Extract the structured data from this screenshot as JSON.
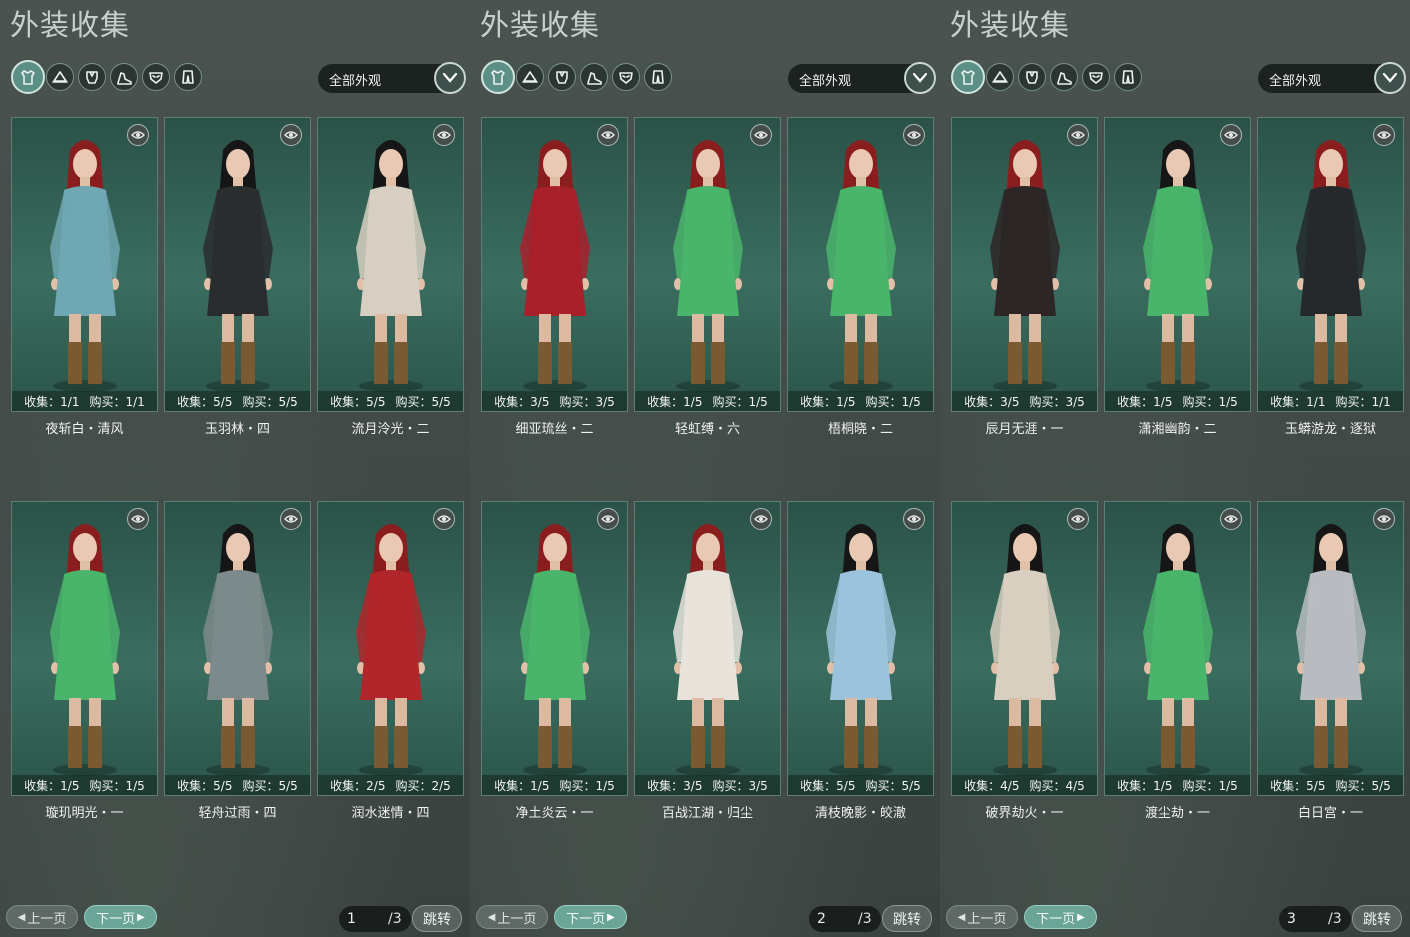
{
  "panels": [
    {
      "title": "外装收集",
      "filter": "全部外观",
      "current_page": "1",
      "total_pages": "/3",
      "buttons": {
        "prev": "上一页",
        "next": "下一页",
        "jump": "跳转"
      },
      "items": [
        {
          "collect": "收集：1/1",
          "buy": "购买：1/1",
          "name": "夜斩白・清风",
          "outfit": "#6fa7b3",
          "hair": "#8a1d1d"
        },
        {
          "collect": "收集：5/5",
          "buy": "购买：5/5",
          "name": "玉羽林・四",
          "outfit": "#2a2d2e",
          "hair": "#161616"
        },
        {
          "collect": "收集：5/5",
          "buy": "购买：5/5",
          "name": "流月泠光・二",
          "outfit": "#d7d0c2",
          "hair": "#161616"
        },
        {
          "collect": "收集：1/5",
          "buy": "购买：1/5",
          "name": "璇玑明光・一",
          "outfit": "#49b56a",
          "hair": "#8a1d1d"
        },
        {
          "collect": "收集：5/5",
          "buy": "购买：5/5",
          "name": "轻舟过雨・四",
          "outfit": "#7d8a8b",
          "hair": "#161616"
        },
        {
          "collect": "收集：2/5",
          "buy": "购买：2/5",
          "name": "润水迷情・四",
          "outfit": "#b0262a",
          "hair": "#8a1d1d"
        }
      ]
    },
    {
      "title": "外装收集",
      "filter": "全部外观",
      "current_page": "2",
      "total_pages": "/3",
      "buttons": {
        "prev": "上一页",
        "next": "下一页",
        "jump": "跳转"
      },
      "items": [
        {
          "collect": "收集：3/5",
          "buy": "购买：3/5",
          "name": "细亚琉丝・二",
          "outfit": "#a8202a",
          "hair": "#8a1d1d"
        },
        {
          "collect": "收集：1/5",
          "buy": "购买：1/5",
          "name": "轻虹缚・六",
          "outfit": "#49b56a",
          "hair": "#8a1d1d"
        },
        {
          "collect": "收集：1/5",
          "buy": "购买：1/5",
          "name": "梧桐晓・二",
          "outfit": "#49b56a",
          "hair": "#8a1d1d"
        },
        {
          "collect": "收集：1/5",
          "buy": "购买：1/5",
          "name": "净土炎云・一",
          "outfit": "#49b56a",
          "hair": "#8a1d1d"
        },
        {
          "collect": "收集：3/5",
          "buy": "购买：3/5",
          "name": "百战江湖・归尘",
          "outfit": "#e8e4dc",
          "hair": "#8a1d1d"
        },
        {
          "collect": "收集：5/5",
          "buy": "购买：5/5",
          "name": "清枝晚影・皎澈",
          "outfit": "#9cc3dc",
          "hair": "#161616"
        }
      ]
    },
    {
      "title": "外装收集",
      "filter": "全部外观",
      "current_page": "3",
      "total_pages": "/3",
      "buttons": {
        "prev": "上一页",
        "next": "下一页",
        "jump": "跳转"
      },
      "items": [
        {
          "collect": "收集：3/5",
          "buy": "购买：3/5",
          "name": "辰月无涯・一",
          "outfit": "#2d2626",
          "hair": "#8a1d1d"
        },
        {
          "collect": "收集：1/5",
          "buy": "购买：1/5",
          "name": "潇湘幽韵・二",
          "outfit": "#49b56a",
          "hair": "#161616"
        },
        {
          "collect": "收集：1/1",
          "buy": "购买：1/1",
          "name": "玉蟒游龙・逐狱",
          "outfit": "#25292c",
          "hair": "#8a1d1d"
        },
        {
          "collect": "收集：4/5",
          "buy": "购买：4/5",
          "name": "破界劫火・一",
          "outfit": "#d8cfc0",
          "hair": "#161616"
        },
        {
          "collect": "收集：1/5",
          "buy": "购买：1/5",
          "name": "渡尘劫・一",
          "outfit": "#49b56a",
          "hair": "#161616"
        },
        {
          "collect": "收集：5/5",
          "buy": "购买：5/5",
          "name": "白日宫・一",
          "outfit": "#b8bcc0",
          "hair": "#161616"
        }
      ]
    }
  ],
  "category_icons": [
    "outfit-icon",
    "hat-icon",
    "top-icon",
    "shoe-icon",
    "mask-icon",
    "lower-icon"
  ],
  "colors": {
    "accent": "#5c8f86",
    "card_bg": "#2f5a4e",
    "next_button": "#6aa597"
  }
}
